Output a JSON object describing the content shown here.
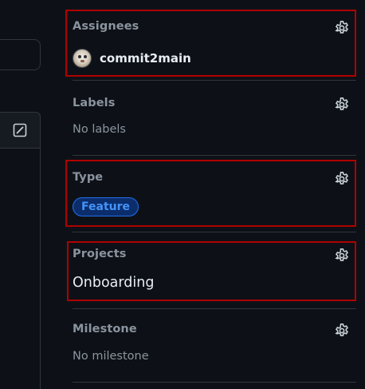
{
  "sidebar": {
    "assignees": {
      "title": "Assignees",
      "user": "commit2main"
    },
    "labels": {
      "title": "Labels",
      "empty": "No labels"
    },
    "type": {
      "title": "Type",
      "value": "Feature"
    },
    "projects": {
      "title": "Projects",
      "value": "Onboarding"
    },
    "milestone": {
      "title": "Milestone",
      "empty": "No milestone"
    }
  },
  "icons": {
    "gear": "gear-icon",
    "edit": "pencil-square-icon"
  },
  "colors": {
    "background": "#0d1117",
    "border": "#30363d",
    "muted_text": "#8b949e",
    "highlight": "#b00000",
    "type_pill_text": "#4493f8",
    "type_pill_bg": "#0c2d6b"
  }
}
